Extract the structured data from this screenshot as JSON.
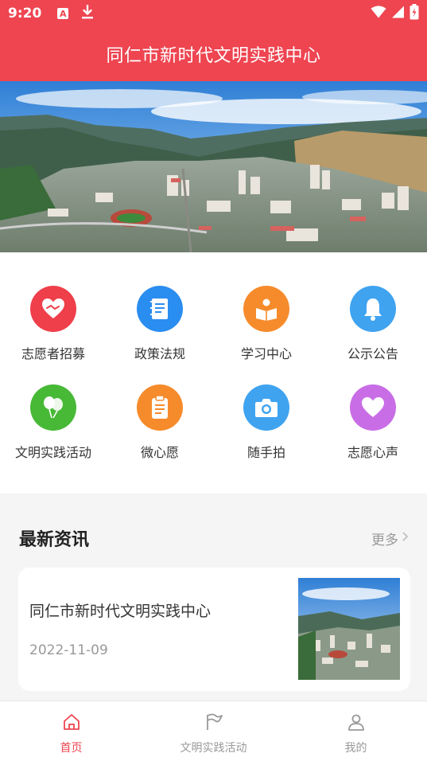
{
  "status_bar": {
    "time": "9:20",
    "a_icon": "A"
  },
  "header": {
    "title": "同仁市新时代文明实践中心"
  },
  "grid": {
    "items": [
      {
        "label": "志愿者招募",
        "icon": "handshake-icon",
        "color": "#ef3f4b"
      },
      {
        "label": "政策法规",
        "icon": "book-icon",
        "color": "#2a8df0"
      },
      {
        "label": "学习中心",
        "icon": "reading-icon",
        "color": "#f68b2b"
      },
      {
        "label": "公示公告",
        "icon": "bell-icon",
        "color": "#3fa3f0"
      },
      {
        "label": "文明实践活动",
        "icon": "balloons-icon",
        "color": "#47b936"
      },
      {
        "label": "微心愿",
        "icon": "clipboard-icon",
        "color": "#f68b2b"
      },
      {
        "label": "随手拍",
        "icon": "camera-icon",
        "color": "#3fa3f0"
      },
      {
        "label": "志愿心声",
        "icon": "heart-icon",
        "color": "#c96de6"
      }
    ]
  },
  "news": {
    "section_title": "最新资讯",
    "more_label": "更多",
    "items": [
      {
        "title": "同仁市新时代文明实践中心",
        "date": "2022-11-09"
      }
    ]
  },
  "tab_bar": {
    "tabs": [
      {
        "label": "首页",
        "icon": "home-icon",
        "active": true
      },
      {
        "label": "文明实践活动",
        "icon": "flag-icon",
        "active": false
      },
      {
        "label": "我的",
        "icon": "user-icon",
        "active": false
      }
    ]
  },
  "colors": {
    "brand": "#ee4551",
    "muted": "#999999"
  }
}
